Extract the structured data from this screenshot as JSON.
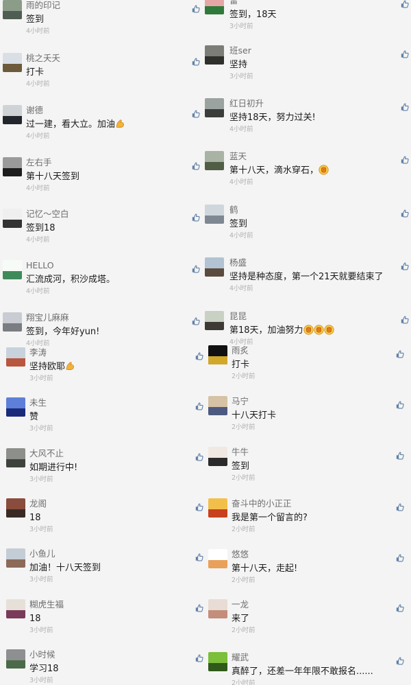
{
  "theme": {
    "background": "#f4f4f4",
    "name_color": "#6d6d6d",
    "text_color": "#1a1a1a",
    "time_color": "#b0b0b0",
    "like_color": "#5f7fa6"
  },
  "left_column": [
    {
      "name": "雨的印记",
      "text": "签到",
      "time": "4小时前",
      "avatar_colors": [
        "#8b9c88",
        "#4f5d52"
      ]
    },
    {
      "name": "桃之夭夭",
      "text": "打卡",
      "time": "4小时前",
      "avatar_colors": [
        "#d9dfe5",
        "#6c5a3a"
      ]
    },
    {
      "name": "谢德",
      "text": "过一建，看大立。加油",
      "emoji": "flexed-biceps",
      "time": "4小时前",
      "avatar_colors": [
        "#cfd3d6",
        "#22262c"
      ]
    },
    {
      "name": "左右手",
      "text": "第十八天签到",
      "time": "4小时前",
      "avatar_colors": [
        "#9a9a9a",
        "#1d1d1d"
      ]
    },
    {
      "name": "记忆～空白",
      "text": "签到18",
      "time": "4小时前",
      "avatar_colors": [
        "#efefef",
        "#333333"
      ]
    },
    {
      "name": "HELLO",
      "text": "汇流成河，积沙成塔。",
      "time": "4小时前",
      "avatar_colors": [
        "#f7fbf7",
        "#3f8a5a"
      ]
    },
    {
      "name": "翔宝儿麻麻",
      "text": "签到，今年好yun!",
      "time": "4小时前",
      "avatar_colors": [
        "#c9ccd2",
        "#7a7d82"
      ]
    },
    {
      "name": "李涛",
      "text": "坚持欧耶",
      "emoji": "flexed-biceps",
      "time": "3小时前",
      "avatar_colors": [
        "#c7d2dd",
        "#b8563f"
      ]
    },
    {
      "name": "未生",
      "text": "赞",
      "time": "3小时前",
      "avatar_colors": [
        "#5e7fd8",
        "#1a2b7a"
      ]
    },
    {
      "name": "大风不止",
      "text": "如期进行中!",
      "time": "3小时前",
      "avatar_colors": [
        "#8c8f8a",
        "#3f433d"
      ]
    },
    {
      "name": "龙阁",
      "text": "18",
      "time": "3小时前",
      "avatar_colors": [
        "#8a4c3c",
        "#3b2a23"
      ]
    },
    {
      "name": "小鱼儿",
      "text": "加油！十八天签到",
      "time": "3小时前",
      "avatar_colors": [
        "#c4cdd6",
        "#8c6a58"
      ]
    },
    {
      "name": "糊虎生福",
      "text": "18",
      "time": "3小时前",
      "avatar_colors": [
        "#e6e0d8",
        "#7a3b5a"
      ]
    },
    {
      "name": "小时候",
      "text": "学习18",
      "time": "3小时前",
      "avatar_colors": [
        "#8d8f90",
        "#4a6a4a"
      ]
    }
  ],
  "right_column": [
    {
      "name": "雷",
      "text": "签到，18天",
      "time": "3小时前",
      "avatar_colors": [
        "#e6a6a6",
        "#2f7a3a"
      ]
    },
    {
      "name": "班ser",
      "text": "坚持",
      "time": "3小时前",
      "avatar_colors": [
        "#7d7d78",
        "#2f2f2c"
      ]
    },
    {
      "name": "红日初升",
      "text": "坚持18天，努力过关!",
      "time": "4小时前",
      "avatar_colors": [
        "#9ba3a0",
        "#3a3d3a"
      ]
    },
    {
      "name": "蓝天",
      "text": "第十八天，滴水穿石，",
      "emoji": "raised-fist",
      "time": "4小时前",
      "avatar_colors": [
        "#a9b3a4",
        "#4f5e45"
      ]
    },
    {
      "name": "鹤",
      "text": "签到",
      "time": "4小时前",
      "avatar_colors": [
        "#cfd6dc",
        "#7d8892"
      ]
    },
    {
      "name": "杨盛",
      "text": "坚持是种态度，第一个21天就要结束了",
      "time": "4小时前",
      "avatar_colors": [
        "#b2c3d3",
        "#5b4b3e"
      ]
    },
    {
      "name": "昆昆",
      "text": "第18天，加油努力",
      "emoji": "raised-fist",
      "emoji_count": 3,
      "time": "4小时前",
      "avatar_colors": [
        "#c9d0c4",
        "#3d3a35"
      ]
    },
    {
      "name": "雨炙",
      "text": "打卡",
      "time": "2小时前",
      "avatar_colors": [
        "#111111",
        "#d1a82a"
      ]
    },
    {
      "name": "马宁",
      "text": "十八天打卡",
      "time": "2小时前",
      "avatar_colors": [
        "#d6c2a4",
        "#4d5a80"
      ]
    },
    {
      "name": "牛牛",
      "text": "签到",
      "time": "2小时前",
      "avatar_colors": [
        "#f1e8e2",
        "#2b2b2b"
      ]
    },
    {
      "name": "奋斗中的小正正",
      "text": "我是第一个留言的?",
      "time": "2小时前",
      "avatar_colors": [
        "#f2c04a",
        "#c8401f"
      ]
    },
    {
      "name": "悠悠",
      "text": "第十八天，走起!",
      "time": "2小时前",
      "avatar_colors": [
        "#ffffff",
        "#e9a05a"
      ]
    },
    {
      "name": "一龙",
      "text": "来了",
      "time": "2小时前",
      "avatar_colors": [
        "#e9dcd4",
        "#c38e7a"
      ]
    },
    {
      "name": "耀武",
      "text": "真醉了，还差一年年限不敢报名......",
      "time": "2小时前",
      "avatar_colors": [
        "#7bbf3a",
        "#2f5a1a"
      ]
    }
  ]
}
